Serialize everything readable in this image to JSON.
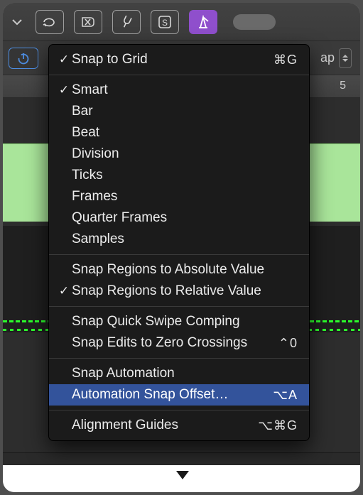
{
  "toolbar": {
    "icons": [
      "dropdown-caret",
      "loop",
      "cancel",
      "tuning-fork",
      "solo-box",
      "metronome"
    ]
  },
  "secondbar": {
    "right_label": "ap"
  },
  "ruler": {
    "marker": "5"
  },
  "menu": {
    "sections": [
      [
        {
          "checked": true,
          "label": "Snap to Grid",
          "shortcut": "⌘G"
        }
      ],
      [
        {
          "checked": true,
          "label": "Smart"
        },
        {
          "checked": false,
          "label": "Bar"
        },
        {
          "checked": false,
          "label": "Beat"
        },
        {
          "checked": false,
          "label": "Division"
        },
        {
          "checked": false,
          "label": "Ticks"
        },
        {
          "checked": false,
          "label": "Frames"
        },
        {
          "checked": false,
          "label": "Quarter Frames"
        },
        {
          "checked": false,
          "label": "Samples"
        }
      ],
      [
        {
          "checked": false,
          "label": "Snap Regions to Absolute Value"
        },
        {
          "checked": true,
          "label": "Snap Regions to Relative Value"
        }
      ],
      [
        {
          "checked": false,
          "label": "Snap Quick Swipe Comping"
        },
        {
          "checked": false,
          "label": "Snap Edits to Zero Crossings",
          "shortcut": "⌃0"
        }
      ],
      [
        {
          "checked": false,
          "label": "Snap Automation"
        },
        {
          "checked": false,
          "label": "Automation Snap Offset…",
          "shortcut": "⌥A",
          "highlighted": true
        }
      ],
      [
        {
          "checked": false,
          "label": "Alignment Guides",
          "shortcut": "⌥⌘G"
        }
      ]
    ]
  }
}
